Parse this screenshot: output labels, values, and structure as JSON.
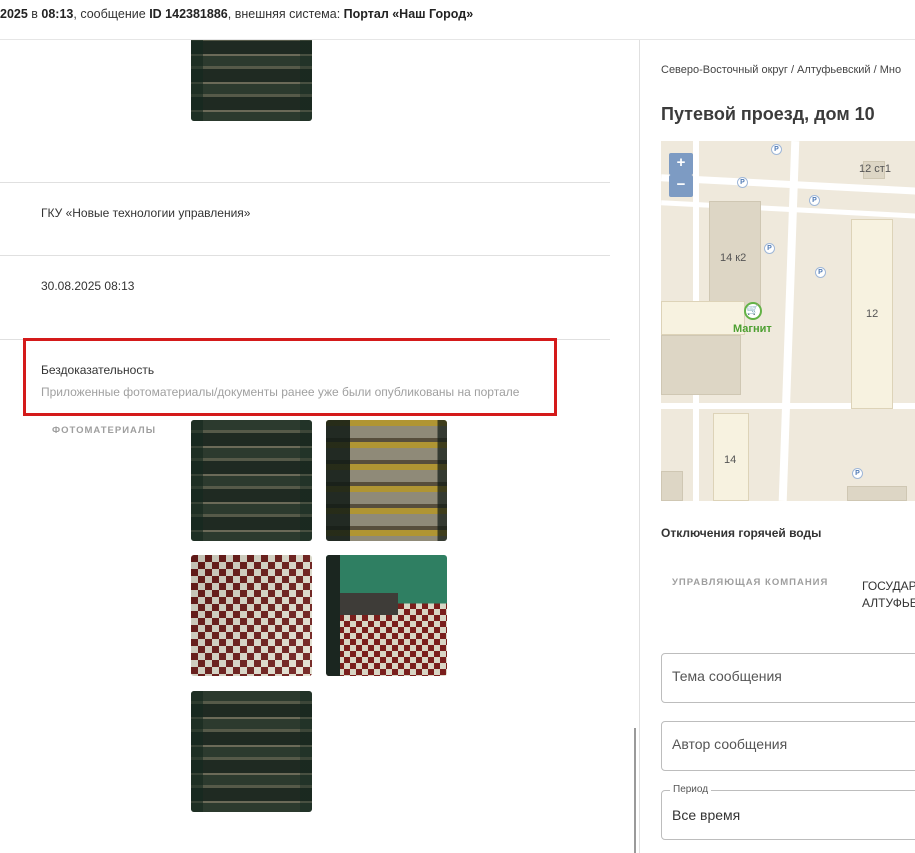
{
  "topbar": {
    "date_fragment": "2025",
    "in_word": " в ",
    "time": "08:13",
    "msg_text": ", сообщение ",
    "msg_id": "ID 142381886",
    "ext_text": ", внешняя система: ",
    "ext_system": "Портал «Наш Город»"
  },
  "left": {
    "organization": "ГКУ «Новые технологии управления»",
    "datetime": "30.08.2025 08:13",
    "status_title": "Бездоказательность",
    "status_desc": "Приложенные фотоматериалы/документы ранее уже были опубликованы на портале",
    "photos_label": "ФОТОМАТЕРИАЛЫ",
    "highlight_color": "#d41a1a"
  },
  "right": {
    "breadcrumb": "Северо-Восточный округ / Алтуфьевский / Мно",
    "address": "Путевой проезд, дом 10",
    "map": {
      "zoom_in": "+",
      "zoom_out": "−",
      "labels": [
        "12 ст1",
        "14 к2",
        "12",
        "14"
      ],
      "shop_name": "Магнит",
      "pin": "P"
    },
    "section_title": "Отключения горячей воды",
    "company_label": "УПРАВЛЯЮЩАЯ КОМПАНИЯ",
    "company_value_line1": "ГОСУДАР",
    "company_value_line2": "АЛТУФЬЕ",
    "fields": {
      "topic_placeholder": "Тема сообщения",
      "author_placeholder": "Автор сообщения",
      "period_legend": "Период",
      "period_value": "Все время"
    }
  }
}
